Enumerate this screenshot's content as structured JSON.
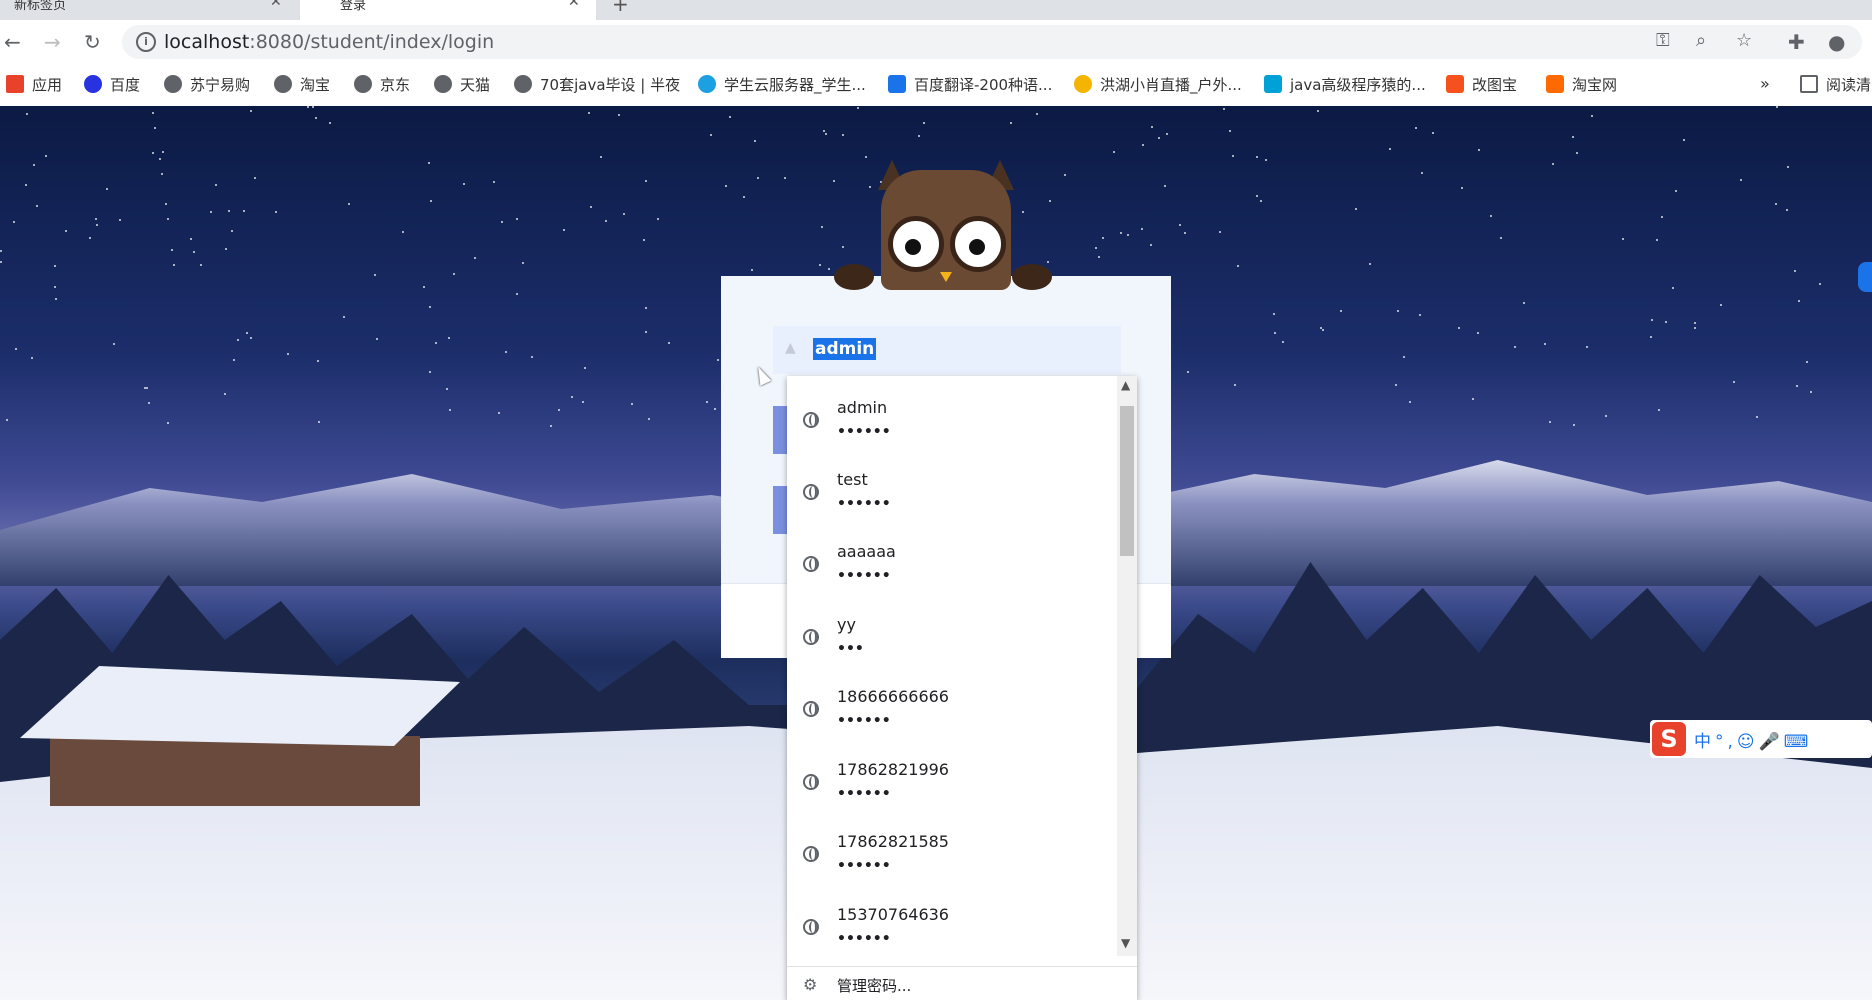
{
  "browser": {
    "tabs": [
      {
        "title": "新标签页",
        "close": "✕"
      },
      {
        "title": "登录",
        "close": "✕"
      }
    ],
    "new_tab": "+",
    "url_host": "localhost",
    "url_rest": ":8080/student/index/login",
    "bookmarks": [
      {
        "label": "应用",
        "icon": "apps-icon"
      },
      {
        "label": "百度",
        "icon": "baidu-icon"
      },
      {
        "label": "苏宁易购",
        "icon": "globe-icon"
      },
      {
        "label": "淘宝",
        "icon": "globe-icon"
      },
      {
        "label": "京东",
        "icon": "globe-icon"
      },
      {
        "label": "天猫",
        "icon": "globe-icon"
      },
      {
        "label": "70套java毕设 | 半夜",
        "icon": "globe-icon"
      },
      {
        "label": "学生云服务器_学生...",
        "icon": "cloud-icon"
      },
      {
        "label": "百度翻译-200种语...",
        "icon": "translate-icon"
      },
      {
        "label": "洪湖小肖直播_户外...",
        "icon": "bird-icon"
      },
      {
        "label": "java高级程序猿的...",
        "icon": "tv-icon"
      },
      {
        "label": "改图宝",
        "icon": "image-icon"
      },
      {
        "label": "淘宝网",
        "icon": "taobao-icon"
      }
    ],
    "more_bookmarks": "»",
    "reading_list": "阅读清"
  },
  "login": {
    "username_value": "admin"
  },
  "autofill": {
    "items": [
      {
        "user": "admin",
        "pass": "••••••"
      },
      {
        "user": "test",
        "pass": "••••••"
      },
      {
        "user": "aaaaaa",
        "pass": "••••••"
      },
      {
        "user": "yy",
        "pass": "•••"
      },
      {
        "user": "18666666666",
        "pass": "••••••"
      },
      {
        "user": "17862821996",
        "pass": "••••••"
      },
      {
        "user": "17862821585",
        "pass": "••••••"
      },
      {
        "user": "15370764636",
        "pass": "••••••"
      }
    ],
    "manage_label": "管理密码..."
  },
  "ime": {
    "logo": "S",
    "tools": "中°,☺🎤⌨"
  },
  "colors": {
    "accent": "#1a73e8",
    "panel_bg": "#f1f6fd",
    "field_bg": "#e8f0fe"
  }
}
